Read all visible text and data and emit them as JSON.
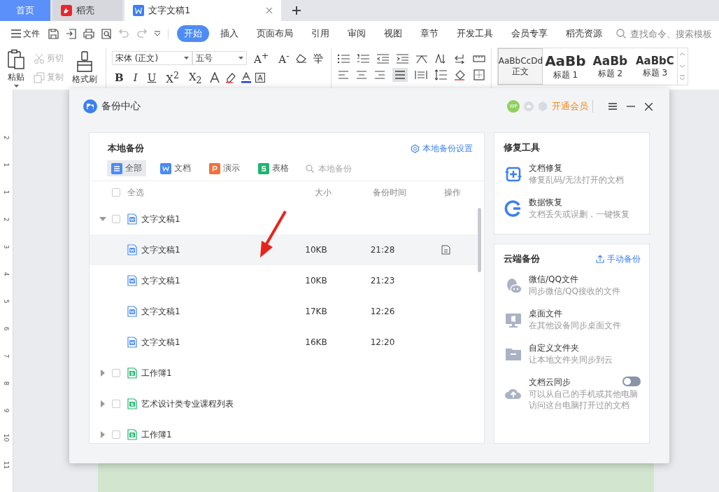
{
  "tabs": [
    {
      "label": "首页",
      "kind": "home",
      "selected": false
    },
    {
      "label": "稻壳",
      "kind": "docer",
      "selected": false
    },
    {
      "label": "文字文稿1",
      "kind": "doc",
      "selected": true
    }
  ],
  "menu": {
    "file": "文件",
    "tabs": [
      {
        "label": "开始",
        "selected": true
      },
      {
        "label": "插入",
        "selected": false
      },
      {
        "label": "页面布局",
        "selected": false
      },
      {
        "label": "引用",
        "selected": false
      },
      {
        "label": "审阅",
        "selected": false
      },
      {
        "label": "视图",
        "selected": false
      },
      {
        "label": "章节",
        "selected": false
      },
      {
        "label": "开发工具",
        "selected": false
      },
      {
        "label": "会员专享",
        "selected": false
      },
      {
        "label": "稻壳资源",
        "selected": false
      }
    ],
    "search": {
      "placeholder": "查找命令、搜索模板"
    }
  },
  "ribbon": {
    "clipboard": [
      {
        "label": "粘贴",
        "kind": "paste",
        "disabled": false
      },
      {
        "label": "剪切",
        "kind": "cut",
        "disabled": true
      },
      {
        "label": "复制",
        "kind": "copy",
        "disabled": true
      },
      {
        "label": "格式刷",
        "kind": "painter",
        "disabled": false
      }
    ],
    "font": {
      "value": "宋体 (正文)"
    },
    "size": {
      "value": "五号"
    },
    "size_buttons": [
      "A$^{+}$",
      "A$^{-}$"
    ],
    "format_buttons": [
      "B",
      "I",
      "U",
      "X$^{2}$",
      "X$_{2}$"
    ],
    "styles": [
      {
        "sample": "AaBbCcDd",
        "name": "正文",
        "kind": "body",
        "selected": true
      },
      {
        "sample": "AaBb",
        "name": "标题 1",
        "kind": "h1",
        "selected": false
      },
      {
        "sample": "AaBb",
        "name": "标题 2",
        "kind": "h2",
        "selected": false
      },
      {
        "sample": "AaBbC",
        "name": "标题 3",
        "kind": "h3",
        "selected": false
      }
    ]
  },
  "ruler": [
    "2",
    "1",
    "1",
    "2",
    "3",
    "4",
    "5",
    "6",
    "7",
    "8",
    "9",
    "10",
    "11"
  ],
  "dialog": {
    "title": "备份中心",
    "avatar": "WP",
    "vip": "开通会员",
    "local": {
      "title": "本地备份",
      "settings": "本地备份设置",
      "filters": [
        {
          "label": "全部",
          "kind": "all",
          "selected": true
        },
        {
          "label": "文档",
          "kind": "doc",
          "selected": false
        },
        {
          "label": "演示",
          "kind": "ppt",
          "selected": false
        },
        {
          "label": "表格",
          "kind": "sheet",
          "selected": false
        }
      ],
      "search": {
        "placeholder": "本地备份"
      },
      "columns": {
        "select_all": "全选",
        "checked": false,
        "size": "大小",
        "time": "备份时间",
        "action": "操作"
      },
      "files": [
        {
          "name": "文字文稿1",
          "kind": "doc",
          "checked": false,
          "expanded": true,
          "selected": false,
          "children": [
            {
              "name": "文字文稿1",
              "kind": "doc",
              "size": "10KB",
              "time": "21:28",
              "selected": true
            },
            {
              "name": "文字文稿1",
              "kind": "doc",
              "size": "10KB",
              "time": "21:23",
              "selected": false
            },
            {
              "name": "文字文稿1",
              "kind": "doc",
              "size": "17KB",
              "time": "12:26",
              "selected": false
            },
            {
              "name": "文字文稿1",
              "kind": "doc",
              "size": "16KB",
              "time": "12:20",
              "selected": false
            }
          ]
        },
        {
          "name": "工作簿1",
          "kind": "sheet",
          "checked": false,
          "expanded": false,
          "selected": false
        },
        {
          "name": "艺术设计类专业课程列表",
          "kind": "sheet",
          "checked": false,
          "expanded": false,
          "selected": false
        },
        {
          "name": "工作簿1",
          "kind": "sheet",
          "checked": false,
          "expanded": false,
          "selected": false
        }
      ]
    },
    "repair": {
      "title": "修复工具",
      "items": [
        {
          "title": "文档修复",
          "desc": "修复乱码/无法打开的文档",
          "kind": "repair"
        },
        {
          "title": "数据恢复",
          "desc": "文档丢失或误删，一键恢复",
          "kind": "recover"
        }
      ]
    },
    "cloud": {
      "title": "云端备份",
      "action": "手动备份",
      "items": [
        {
          "title": "微信/QQ文件",
          "desc": "同步微信/QQ接收的文件",
          "kind": "chat"
        },
        {
          "title": "桌面文件",
          "desc": "在其他设备同步桌面文件",
          "kind": "desktop"
        },
        {
          "title": "自定义文件夹",
          "desc": "让本地文件夹同步到云",
          "kind": "folder"
        },
        {
          "title": "文档云同步",
          "desc": "可以从自己的手机或其他电脑访问这台电脑打开过的文档",
          "kind": "sync",
          "on": false
        }
      ]
    }
  }
}
